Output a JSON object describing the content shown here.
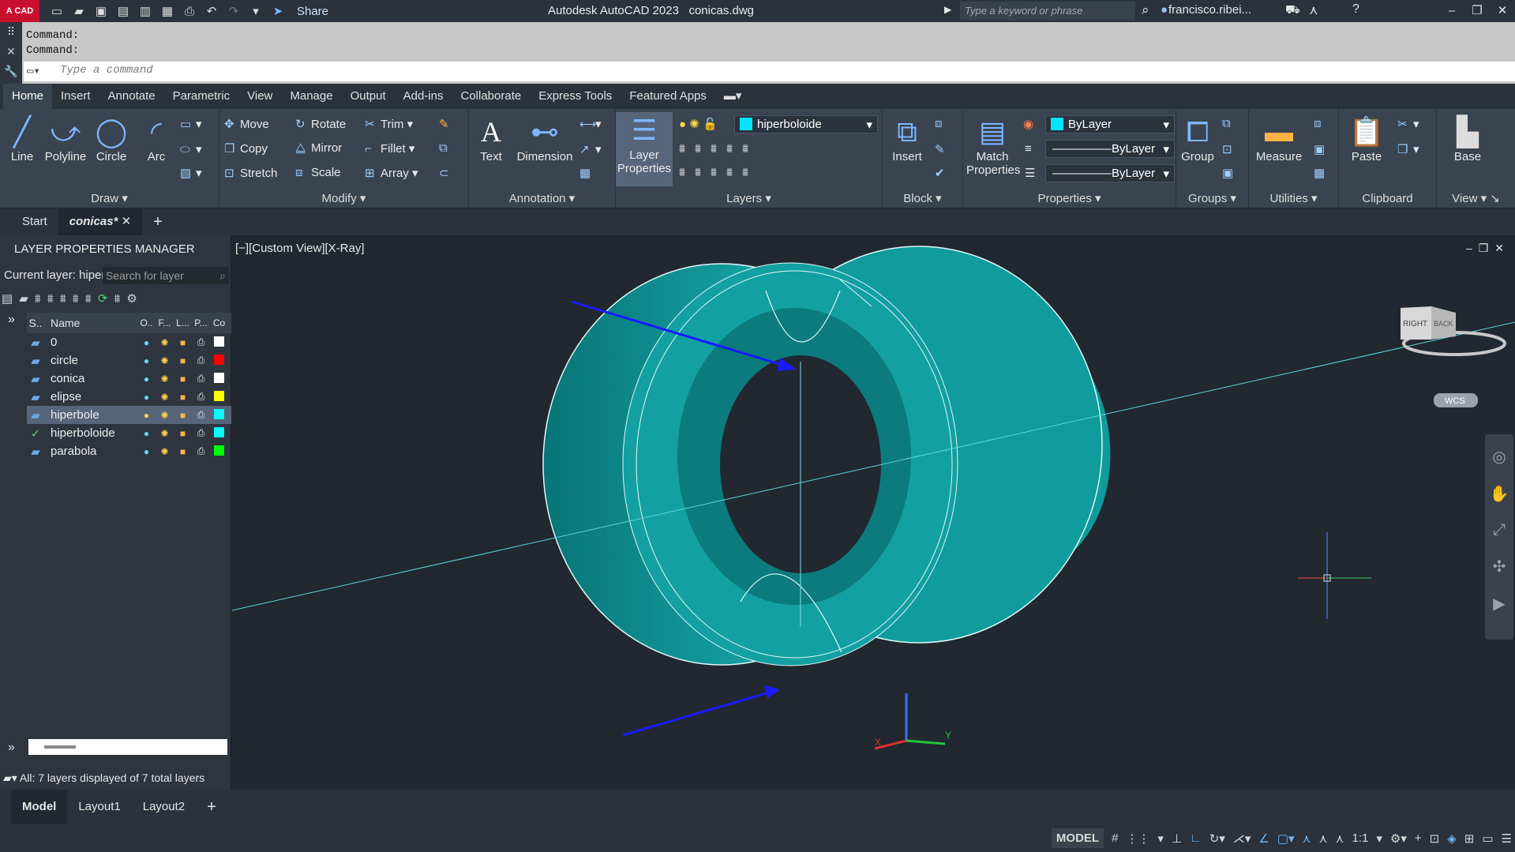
{
  "titlebar": {
    "logo": "A CAD",
    "share_label": "Share",
    "title": "Autodesk AutoCAD 2023",
    "filename": "conicas.dwg",
    "search_placeholder": "Type a keyword or phrase",
    "user": "francisco.ribei..."
  },
  "command": {
    "history": [
      "Command:",
      "Command:"
    ],
    "placeholder": "Type  a  command"
  },
  "ribbon_tabs": [
    "Home",
    "Insert",
    "Annotate",
    "Parametric",
    "View",
    "Manage",
    "Output",
    "Add-ins",
    "Collaborate",
    "Express Tools",
    "Featured Apps"
  ],
  "ribbon": {
    "draw": {
      "title": "Draw",
      "line": "Line",
      "polyline": "Polyline",
      "circle": "Circle",
      "arc": "Arc"
    },
    "modify": {
      "title": "Modify",
      "move": "Move",
      "rotate": "Rotate",
      "trim": "Trim",
      "copy": "Copy",
      "mirror": "Mirror",
      "fillet": "Fillet",
      "stretch": "Stretch",
      "scale": "Scale",
      "array": "Array"
    },
    "annotation": {
      "title": "Annotation",
      "text": "Text",
      "dimension": "Dimension"
    },
    "layers": {
      "title": "Layers",
      "layer_properties": [
        "Layer",
        "Properties"
      ],
      "current": "hiperboloide"
    },
    "block": {
      "title": "Block",
      "insert": "Insert"
    },
    "properties": {
      "title": "Properties",
      "match": [
        "Match",
        "Properties"
      ],
      "color": "ByLayer",
      "lineweight": "ByLayer",
      "linetype": "ByLayer"
    },
    "groups": {
      "title": "Groups",
      "group": "Group"
    },
    "utilities": {
      "title": "Utilities",
      "measure": "Measure"
    },
    "clipboard": {
      "title": "Clipboard",
      "paste": "Paste"
    },
    "view": {
      "title": "View",
      "base": "Base"
    }
  },
  "doc_tabs": {
    "start": "Start",
    "active": "conicas*"
  },
  "layer_manager": {
    "title": "LAYER PROPERTIES MANAGER",
    "current_label": "Current layer: hiper",
    "search_placeholder": "Search for layer",
    "headers": [
      "S..",
      "Name",
      "O..",
      "F...",
      "L...",
      "P...",
      "Co"
    ],
    "layers": [
      {
        "name": "0",
        "color": "#ffffff"
      },
      {
        "name": "circle",
        "color": "#ff0000"
      },
      {
        "name": "conica",
        "color": "#ffffff"
      },
      {
        "name": "elipse",
        "color": "#ffff00"
      },
      {
        "name": "hiperbole",
        "color": "#00ffff"
      },
      {
        "name": "hiperboloide",
        "color": "#00ffff"
      },
      {
        "name": "parabola",
        "color": "#00ff00"
      }
    ],
    "status": "All: 7 layers displayed of 7 total layers"
  },
  "viewport": {
    "label": "[−][Custom View][X-Ray]",
    "viewcube_right": "RIGHT",
    "viewcube_back": "BACK",
    "wcs": "WCS",
    "ucs_y": "Y",
    "ucs_x": "X"
  },
  "layout_tabs": [
    "Model",
    "Layout1",
    "Layout2"
  ],
  "statusbar": {
    "model": "MODEL",
    "scale": "1:1"
  }
}
